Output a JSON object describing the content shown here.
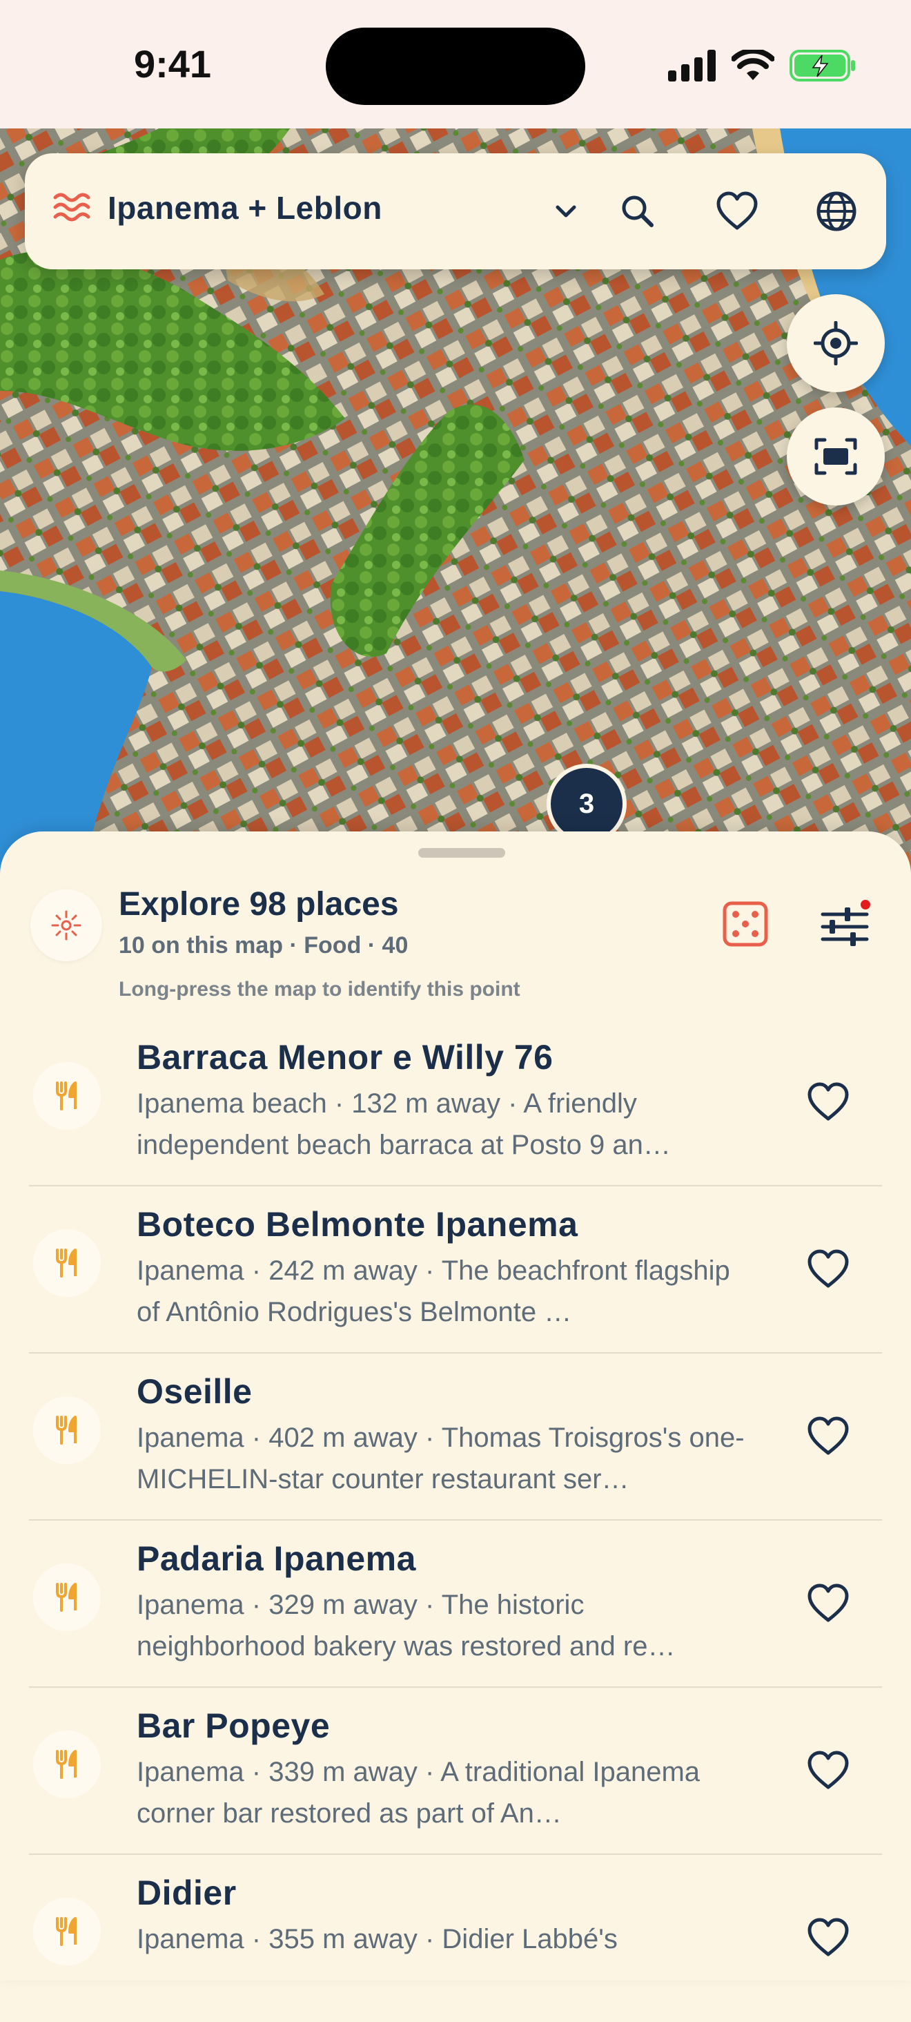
{
  "status": {
    "time": "9:41"
  },
  "search_bar": {
    "location": "Ipanema + Leblon"
  },
  "map": {
    "cluster_count": "3"
  },
  "explore": {
    "title": "Explore 98 places",
    "subtitle": "10 on this map · Food · 40",
    "hint": "Long-press the map to identify this point"
  },
  "places": [
    {
      "name": "Barraca Menor e Willy 76",
      "description": "Ipanema beach · 132 m away · A friendly independent beach barraca at Posto 9 an…"
    },
    {
      "name": "Boteco Belmonte Ipanema",
      "description": "Ipanema · 242 m away · The beachfront flagship of Antônio Rodrigues's Belmonte …"
    },
    {
      "name": "Oseille",
      "description": "Ipanema · 402 m away · Thomas Troisgros's one-MICHELIN-star counter restaurant ser…"
    },
    {
      "name": "Padaria Ipanema",
      "description": "Ipanema · 329 m away · The historic neighborhood bakery was restored and re…"
    },
    {
      "name": "Bar Popeye",
      "description": "Ipanema · 339 m away · A traditional Ipanema corner bar restored as part of An…"
    },
    {
      "name": "Didier",
      "description": "Ipanema · 355 m away · Didier Labbé's"
    }
  ],
  "colors": {
    "navy": "#1b2f4b",
    "accent_red": "#e8604c",
    "food_icon": "#f0a531",
    "sheet_bg": "#fdf5e4",
    "battery_green": "#4cd964"
  },
  "icons": {
    "location": "waves-icon",
    "search": "search-icon",
    "favorite": "heart-icon",
    "language": "globe-icon",
    "locate": "crosshair-icon",
    "fit": "fit-bounds-icon",
    "random": "dice-icon",
    "filters": "sliders-icon",
    "category": "fork-knife-icon"
  }
}
